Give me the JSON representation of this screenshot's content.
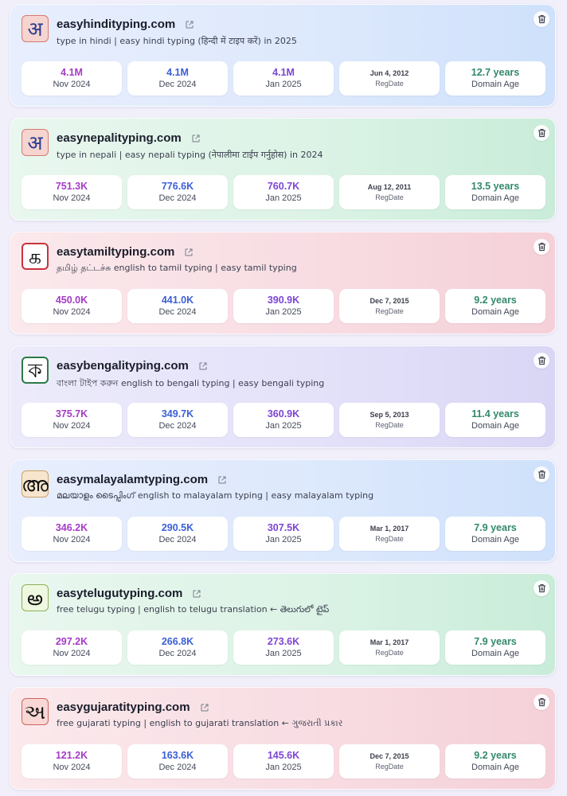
{
  "colors": {
    "nov_value": "#a43bc6",
    "dec_value": "#3b5fd6",
    "jan_value": "#7c45d4",
    "age_value": "#33896a"
  },
  "icons": {
    "external_link": "external-link-icon",
    "delete": "trash-icon"
  },
  "sites": [
    {
      "domain": "easyhindityping.com",
      "logo": "अ",
      "description": "type in hindi | easy hindi typing (हिन्दी में टाइप करें) in 2025",
      "nov": {
        "value": "4.1M",
        "label": "Nov 2024"
      },
      "dec": {
        "value": "4.1M",
        "label": "Dec 2024"
      },
      "jan": {
        "value": "4.1M",
        "label": "Jan 2025"
      },
      "regdate": {
        "value": "Jun 4, 2012",
        "label": "RegDate"
      },
      "age": {
        "value": "12.7 years",
        "label": "Domain Age"
      }
    },
    {
      "domain": "easynepalityping.com",
      "logo": "अ",
      "description": "type in nepali | easy nepali typing (नेपालीमा टाईप गर्नुहोस) in 2024",
      "nov": {
        "value": "751.3K",
        "label": "Nov 2024"
      },
      "dec": {
        "value": "776.6K",
        "label": "Dec 2024"
      },
      "jan": {
        "value": "760.7K",
        "label": "Jan 2025"
      },
      "regdate": {
        "value": "Aug 12, 2011",
        "label": "RegDate"
      },
      "age": {
        "value": "13.5 years",
        "label": "Domain Age"
      }
    },
    {
      "domain": "easytamiltyping.com",
      "logo": "க",
      "description": "தமிழ் தட்டச்சு english to tamil typing | easy tamil typing",
      "nov": {
        "value": "450.0K",
        "label": "Nov 2024"
      },
      "dec": {
        "value": "441.0K",
        "label": "Dec 2024"
      },
      "jan": {
        "value": "390.9K",
        "label": "Jan 2025"
      },
      "regdate": {
        "value": "Dec 7, 2015",
        "label": "RegDate"
      },
      "age": {
        "value": "9.2 years",
        "label": "Domain Age"
      }
    },
    {
      "domain": "easybengalityping.com",
      "logo": "ক",
      "description": "বাংলা টাইপ করুন english to bengali typing | easy bengali typing",
      "nov": {
        "value": "375.7K",
        "label": "Nov 2024"
      },
      "dec": {
        "value": "349.7K",
        "label": "Dec 2024"
      },
      "jan": {
        "value": "360.9K",
        "label": "Jan 2025"
      },
      "regdate": {
        "value": "Sep 5, 2013",
        "label": "RegDate"
      },
      "age": {
        "value": "11.4 years",
        "label": "Domain Age"
      }
    },
    {
      "domain": "easymalayalamtyping.com",
      "logo": "അ",
      "description": "മലയാളം ടൈപ്പിംഗ് english to malayalam typing | easy malayalam typing",
      "nov": {
        "value": "346.2K",
        "label": "Nov 2024"
      },
      "dec": {
        "value": "290.5K",
        "label": "Dec 2024"
      },
      "jan": {
        "value": "307.5K",
        "label": "Jan 2025"
      },
      "regdate": {
        "value": "Mar 1, 2017",
        "label": "RegDate"
      },
      "age": {
        "value": "7.9 years",
        "label": "Domain Age"
      }
    },
    {
      "domain": "easytelugutyping.com",
      "logo": "అ",
      "description": "free telugu typing | english to telugu translation ← తెలుగులో టైప్",
      "nov": {
        "value": "297.2K",
        "label": "Nov 2024"
      },
      "dec": {
        "value": "266.8K",
        "label": "Dec 2024"
      },
      "jan": {
        "value": "273.6K",
        "label": "Jan 2025"
      },
      "regdate": {
        "value": "Mar 1, 2017",
        "label": "RegDate"
      },
      "age": {
        "value": "7.9 years",
        "label": "Domain Age"
      }
    },
    {
      "domain": "easygujaratityping.com",
      "logo": "અ",
      "description": "free gujarati typing | english to gujarati translation ← ગુજરાતી પ્રકાર",
      "nov": {
        "value": "121.2K",
        "label": "Nov 2024"
      },
      "dec": {
        "value": "163.6K",
        "label": "Dec 2024"
      },
      "jan": {
        "value": "145.6K",
        "label": "Jan 2025"
      },
      "regdate": {
        "value": "Dec 7, 2015",
        "label": "RegDate"
      },
      "age": {
        "value": "9.2 years",
        "label": "Domain Age"
      }
    }
  ]
}
